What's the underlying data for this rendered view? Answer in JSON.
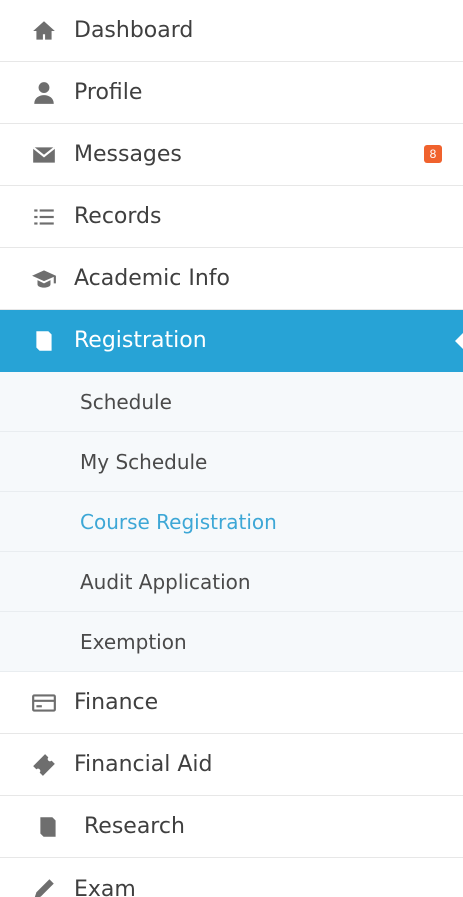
{
  "nav": {
    "dashboard": "Dashboard",
    "profile": "Profile",
    "messages": "Messages",
    "messages_badge": "8",
    "records": "Records",
    "academic_info": "Academic Info",
    "registration": "Registration",
    "finance": "Finance",
    "financial_aid": "Financial Aid",
    "research": "Research",
    "exam": "Exam"
  },
  "registration_submenu": {
    "schedule": "Schedule",
    "my_schedule": "My Schedule",
    "course_registration": "Course Registration",
    "audit_application": "Audit Application",
    "exemption": "Exemption"
  },
  "colors": {
    "active_background": "#27a3d6",
    "active_text": "#ffffff",
    "current_link": "#3da7d6",
    "badge": "#f0622d"
  }
}
